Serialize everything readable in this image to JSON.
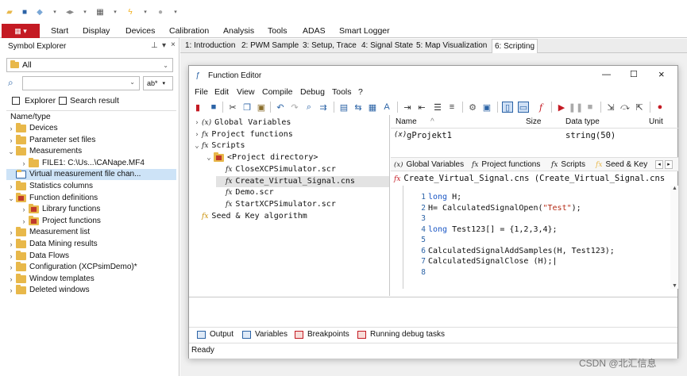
{
  "main_menu": [
    "Start",
    "Display",
    "Devices",
    "Calibration",
    "Analysis",
    "Tools",
    "ADAS",
    "Smart Logger"
  ],
  "symbol_explorer": {
    "title": "Symbol Explorer",
    "filter_value": "All",
    "search_value": "",
    "search_mode": "ab*",
    "tab_explorer": "Explorer",
    "tab_search": "Search result",
    "column_header": "Name/type",
    "tree": [
      {
        "label": "Devices",
        "indent": 0,
        "exp": "›"
      },
      {
        "label": "Parameter set files",
        "indent": 0,
        "exp": "›"
      },
      {
        "label": "Measurements",
        "indent": 0,
        "exp": "⌄"
      },
      {
        "label": "FILE1: C:\\Us...\\CANape.MF4",
        "indent": 1,
        "exp": "›"
      },
      {
        "label": "Virtual measurement file chan...",
        "indent": 0,
        "exp": "",
        "selected": true
      },
      {
        "label": "Statistics columns",
        "indent": 0,
        "exp": "›"
      },
      {
        "label": "Function definitions",
        "indent": 0,
        "exp": "⌄",
        "star": true
      },
      {
        "label": "Library functions",
        "indent": 1,
        "exp": "›",
        "star": true
      },
      {
        "label": "Project functions",
        "indent": 1,
        "exp": "›",
        "star": true
      },
      {
        "label": "Measurement list",
        "indent": 0,
        "exp": "›"
      },
      {
        "label": "Data Mining results",
        "indent": 0,
        "exp": "›"
      },
      {
        "label": "Data Flows",
        "indent": 0,
        "exp": "›"
      },
      {
        "label": "Configuration (XCPsimDemo)*",
        "indent": 0,
        "exp": "›"
      },
      {
        "label": "Window templates",
        "indent": 0,
        "exp": "›"
      },
      {
        "label": "Deleted windows",
        "indent": 0,
        "exp": "›"
      }
    ]
  },
  "tabs": [
    "1: Introduction",
    "2: PWM Sample",
    "3: Setup, Trace",
    "4: Signal State",
    "5: Map Visualization",
    "6: Scripting"
  ],
  "function_editor": {
    "title": "Function Editor",
    "menu": [
      "File",
      "Edit",
      "View",
      "Compile",
      "Debug",
      "Tools",
      "?"
    ],
    "tree": [
      {
        "label": "Global Variables",
        "exp": "›",
        "icon": "(x)",
        "indent": 0
      },
      {
        "label": "Project functions",
        "exp": "›",
        "icon": "fx",
        "indent": 0
      },
      {
        "label": "Scripts",
        "exp": "⌄",
        "icon": "fx",
        "indent": 0
      },
      {
        "label": "<Project directory>",
        "exp": "⌄",
        "icon": "folder",
        "indent": 1
      },
      {
        "label": "CloseXCPSimulator.scr",
        "exp": "",
        "icon": "fx",
        "indent": 2
      },
      {
        "label": "Create_Virtual_Signal.cns",
        "exp": "",
        "icon": "fx",
        "indent": 2,
        "selected": true
      },
      {
        "label": "Demo.scr",
        "exp": "",
        "icon": "fx",
        "indent": 2
      },
      {
        "label": "StartXCPSimulator.scr",
        "exp": "",
        "icon": "fx",
        "indent": 2
      },
      {
        "label": "Seed & Key algorithm",
        "exp": "",
        "icon": "fx",
        "indent": 0
      }
    ],
    "var_table": {
      "headers": [
        "Name",
        "Size",
        "Data type",
        "Unit"
      ],
      "rows": [
        {
          "icon": "(x)",
          "name": "gProjekt1",
          "size": "",
          "type": "string(50)",
          "unit": ""
        }
      ]
    },
    "right_tabs": [
      "Global Variables",
      "Project functions",
      "Scripts",
      "Seed & Key"
    ],
    "code_title": "Create_Virtual_Signal.cns (Create_Virtual_Signal.cns",
    "code_lines": [
      "long H;",
      "H= CalculatedSignalOpen(\"Test\");",
      "",
      "long Test123[] = {1,2,3,4};",
      "",
      "CalculatedSignalAddSamples(H, Test123);",
      "CalculatedSignalClose (H);",
      ""
    ],
    "bottom_tabs": [
      "Output",
      "Variables",
      "Breakpoints",
      "Running debug tasks"
    ],
    "status": "Ready"
  },
  "watermark": "CSDN @北汇信息"
}
